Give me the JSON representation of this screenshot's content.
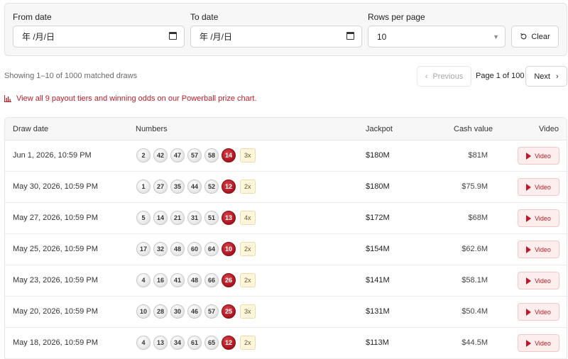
{
  "filters": {
    "from_label": "From date",
    "from_value": "年 /月/日",
    "to_label": "To date",
    "to_value": "年 /月/日",
    "rows_label": "Rows per page",
    "rows_value": "10",
    "clear_label": "Clear"
  },
  "pagination": {
    "showing": "Showing 1–10 of 1000 matched draws",
    "prev_label": "Previous",
    "page_indicator": "Page 1 of 100",
    "next_label": "Next"
  },
  "prize_link": "View all 9 payout tiers and winning odds on our Powerball prize chart.",
  "table": {
    "headers": {
      "draw_date": "Draw date",
      "numbers": "Numbers",
      "jackpot": "Jackpot",
      "cash_value": "Cash value",
      "video": "Video"
    },
    "video_label": "Video",
    "rows": [
      {
        "date": "Jun 1, 2026, 10:59 PM",
        "balls": [
          "2",
          "42",
          "47",
          "57",
          "58"
        ],
        "powerball": "14",
        "multiplier": "3x",
        "jackpot": "$180M",
        "cash": "$81M"
      },
      {
        "date": "May 30, 2026, 10:59 PM",
        "balls": [
          "1",
          "27",
          "35",
          "44",
          "52"
        ],
        "powerball": "12",
        "multiplier": "2x",
        "jackpot": "$180M",
        "cash": "$75.9M"
      },
      {
        "date": "May 27, 2026, 10:59 PM",
        "balls": [
          "5",
          "14",
          "21",
          "31",
          "51"
        ],
        "powerball": "13",
        "multiplier": "4x",
        "jackpot": "$172M",
        "cash": "$68M"
      },
      {
        "date": "May 25, 2026, 10:59 PM",
        "balls": [
          "17",
          "32",
          "48",
          "60",
          "64"
        ],
        "powerball": "10",
        "multiplier": "2x",
        "jackpot": "$154M",
        "cash": "$62.6M"
      },
      {
        "date": "May 23, 2026, 10:59 PM",
        "balls": [
          "4",
          "16",
          "41",
          "48",
          "66"
        ],
        "powerball": "26",
        "multiplier": "2x",
        "jackpot": "$141M",
        "cash": "$58.1M"
      },
      {
        "date": "May 20, 2026, 10:59 PM",
        "balls": [
          "10",
          "28",
          "30",
          "46",
          "57"
        ],
        "powerball": "25",
        "multiplier": "3x",
        "jackpot": "$131M",
        "cash": "$50.4M"
      },
      {
        "date": "May 18, 2026, 10:59 PM",
        "balls": [
          "4",
          "13",
          "34",
          "61",
          "65"
        ],
        "powerball": "12",
        "multiplier": "2x",
        "jackpot": "$113M",
        "cash": "$44.5M"
      }
    ]
  },
  "colors": {
    "accent_red": "#b81d2a",
    "powerball_red": "#a8131d",
    "multiplier_bg": "#fdf5dc"
  }
}
